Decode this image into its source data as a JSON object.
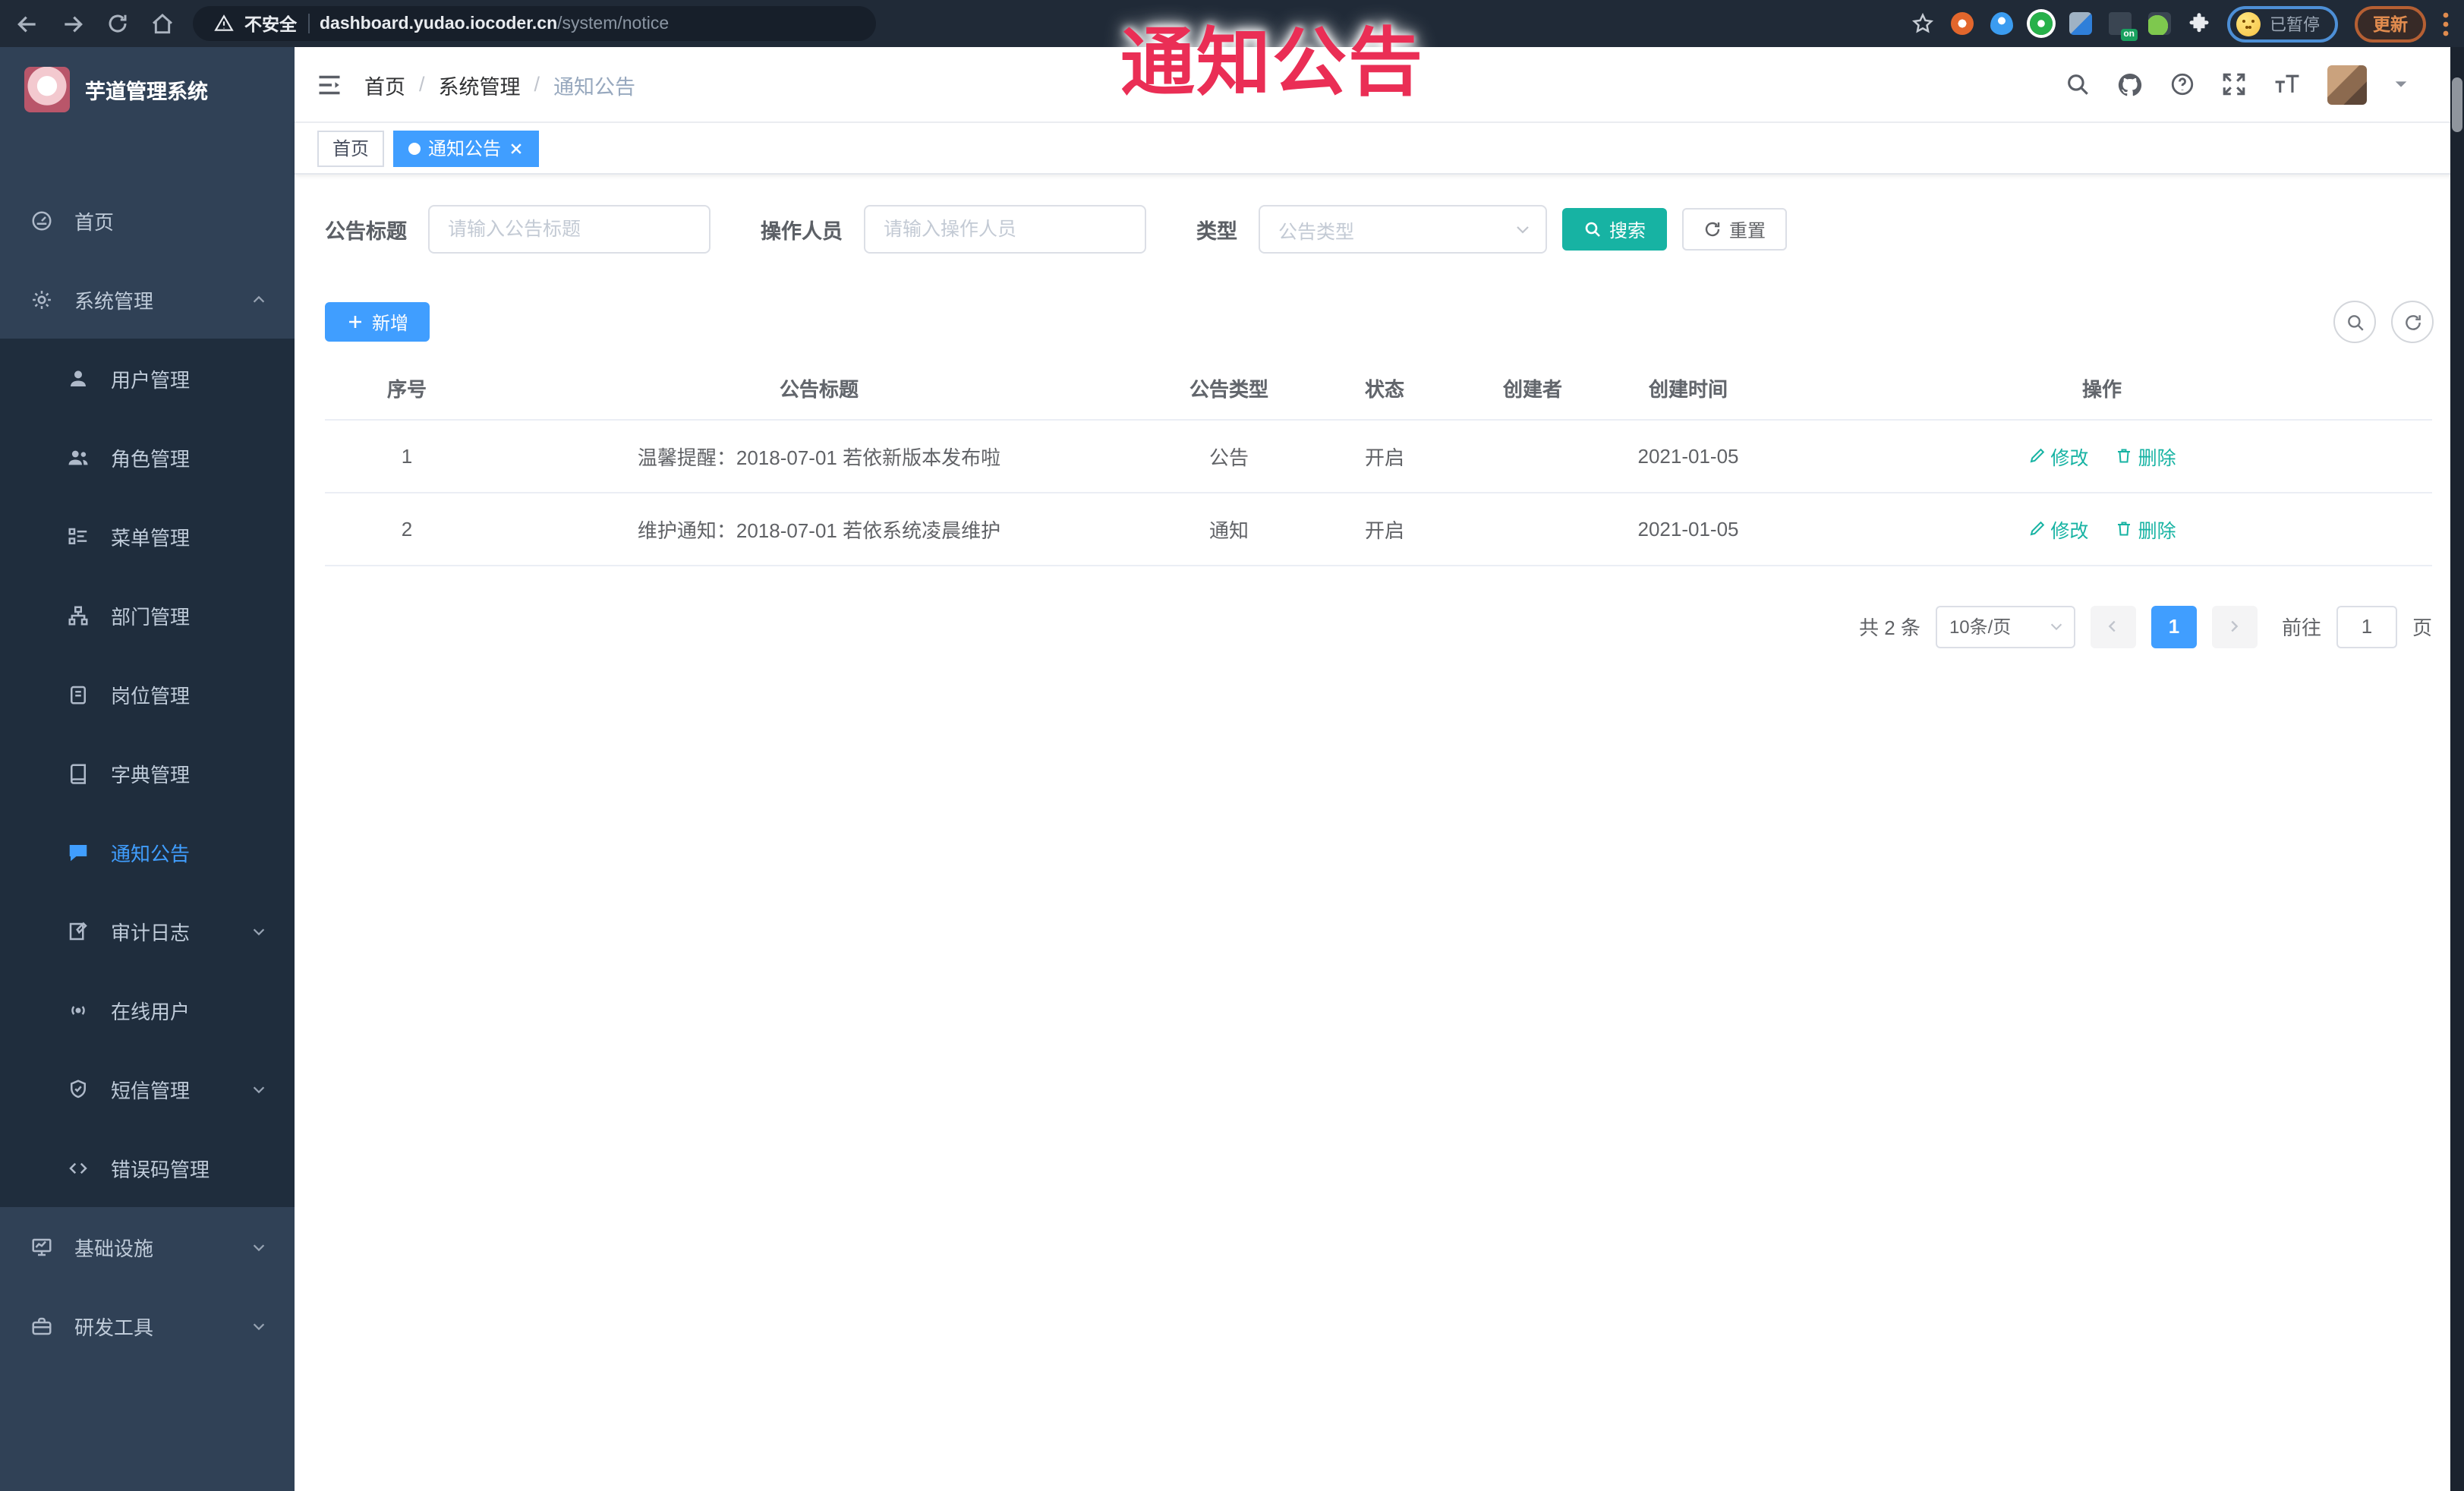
{
  "annotation": {
    "text": "通知公告",
    "color": "#EA2E55"
  },
  "browser": {
    "security_label": "不安全",
    "url_host": "dashboard.yudao.iocoder.cn",
    "url_path": "/system/notice",
    "ext_badge": "on",
    "paused_label": "已暂停",
    "update_label": "更新"
  },
  "sidebar": {
    "title": "芋道管理系统",
    "items": [
      {
        "label": "首页",
        "icon": "dashboard-icon"
      },
      {
        "label": "系统管理",
        "icon": "gear-icon",
        "arrow": "up"
      },
      {
        "label": "用户管理",
        "icon": "user-icon"
      },
      {
        "label": "角色管理",
        "icon": "roles-icon"
      },
      {
        "label": "菜单管理",
        "icon": "menu-tree-icon"
      },
      {
        "label": "部门管理",
        "icon": "org-icon"
      },
      {
        "label": "岗位管理",
        "icon": "badge-icon"
      },
      {
        "label": "字典管理",
        "icon": "book-icon"
      },
      {
        "label": "通知公告",
        "icon": "notice-icon",
        "active": true
      },
      {
        "label": "审计日志",
        "icon": "audit-icon",
        "arrow": "down"
      },
      {
        "label": "在线用户",
        "icon": "online-icon"
      },
      {
        "label": "短信管理",
        "icon": "sms-shield-icon",
        "arrow": "down"
      },
      {
        "label": "错误码管理",
        "icon": "code-icon"
      },
      {
        "label": "基础设施",
        "icon": "monitor-icon",
        "arrow": "down"
      },
      {
        "label": "研发工具",
        "icon": "toolbox-icon",
        "arrow": "down"
      }
    ]
  },
  "navbar": {
    "breadcrumb": [
      "首页",
      "系统管理",
      "通知公告"
    ],
    "separator": "/"
  },
  "tags": [
    {
      "label": "首页",
      "active": false
    },
    {
      "label": "通知公告",
      "active": true
    }
  ],
  "filters": {
    "title_label": "公告标题",
    "title_placeholder": "请输入公告标题",
    "operator_label": "操作人员",
    "operator_placeholder": "请输入操作人员",
    "type_label": "类型",
    "type_placeholder": "公告类型",
    "search_label": "搜索",
    "reset_label": "重置"
  },
  "toolbar": {
    "add_label": "新增"
  },
  "table": {
    "columns": [
      "序号",
      "公告标题",
      "公告类型",
      "状态",
      "创建者",
      "创建时间",
      "操作"
    ],
    "edit_label": "修改",
    "delete_label": "删除",
    "rows": [
      {
        "index": "1",
        "title": "温馨提醒：2018-07-01 若依新版本发布啦",
        "type": "公告",
        "status": "开启",
        "creator": "",
        "created": "2021-01-05"
      },
      {
        "index": "2",
        "title": "维护通知：2018-07-01 若依系统凌晨维护",
        "type": "通知",
        "status": "开启",
        "creator": "",
        "created": "2021-01-05"
      }
    ]
  },
  "pagination": {
    "total_label": "共 2 条",
    "page_size": "10条/页",
    "current_page": "1",
    "goto_label": "前往",
    "goto_value": "1",
    "page_label": "页"
  },
  "colors": {
    "accent_blue": "#409EFF",
    "theme_teal": "#17B3A3",
    "annotation_red": "#EA2E55",
    "sidebar_bg": "#304156",
    "submenu_bg": "#1F2D3D",
    "sidebar_text": "#BFCBD9",
    "chrome_bg": "#202A37",
    "update_orange": "#E08B4E"
  }
}
